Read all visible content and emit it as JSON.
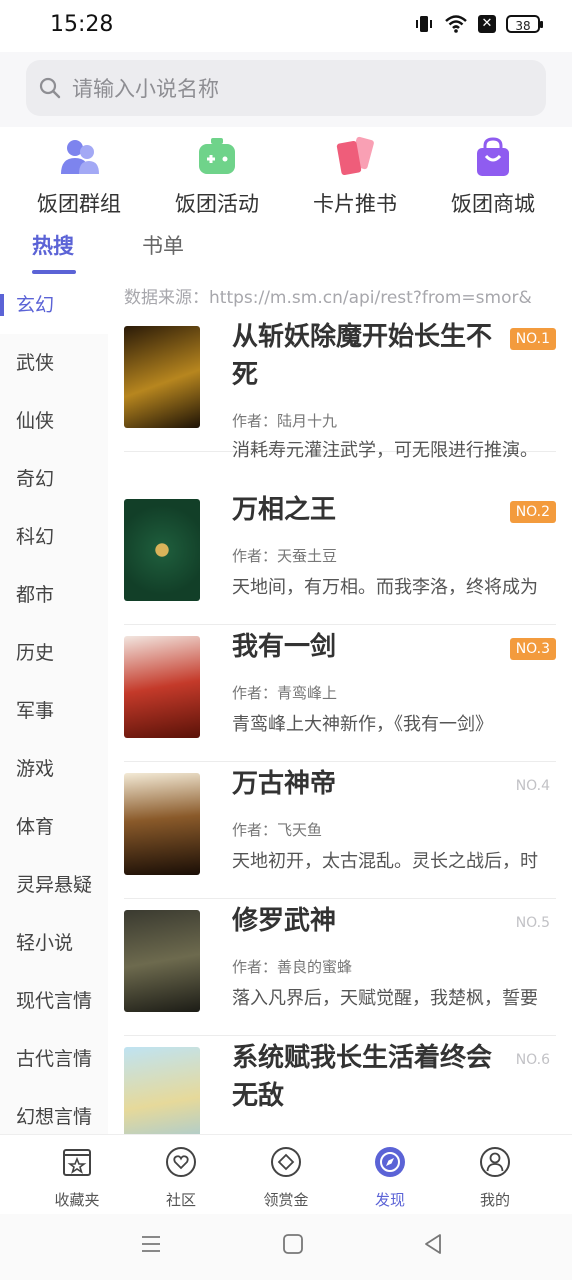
{
  "status": {
    "time": "15:28",
    "battery": "38"
  },
  "search": {
    "placeholder": "请输入小说名称"
  },
  "quick_actions": [
    {
      "label": "饭团群组",
      "icon": "group-users-icon"
    },
    {
      "label": "饭团活动",
      "icon": "game-controller-icon"
    },
    {
      "label": "卡片推书",
      "icon": "cards-icon"
    },
    {
      "label": "饭团商城",
      "icon": "shopping-bag-icon"
    }
  ],
  "tabs": [
    {
      "label": "热搜",
      "active": true
    },
    {
      "label": "书单",
      "active": false
    }
  ],
  "categories": [
    "玄幻",
    "武侠",
    "仙侠",
    "奇幻",
    "科幻",
    "都市",
    "历史",
    "军事",
    "游戏",
    "体育",
    "灵异悬疑",
    "轻小说",
    "现代言情",
    "古代言情",
    "幻想言情"
  ],
  "active_category": "玄幻",
  "source_note": "数据来源：https://m.sm.cn/api/rest?from=smor&",
  "books": [
    {
      "title": "从斩妖除魔开始长生不死",
      "author": "作者：陆月十九",
      "desc": "消耗寿元灌注武学，可无限进行推演。",
      "rank": "NO.1"
    },
    {
      "title": "万相之王",
      "author": "作者：天蚕土豆",
      "desc": "天地间，有万相。而我李洛，终将成为",
      "rank": "NO.2"
    },
    {
      "title": "我有一剑",
      "author": "作者：青鸾峰上",
      "desc": "青鸾峰上大神新作，《我有一剑》",
      "rank": "NO.3"
    },
    {
      "title": "万古神帝",
      "author": "作者：飞天鱼",
      "desc": "天地初开，太古混乱。灵长之战后，时",
      "rank": "NO.4"
    },
    {
      "title": "修罗武神",
      "author": "作者：善良的蜜蜂",
      "desc": "落入凡界后，天赋觉醒，我楚枫，誓要",
      "rank": "NO.5"
    },
    {
      "title": "系统赋我长生活着终会无敌",
      "author": "",
      "desc": "",
      "rank": "NO.6"
    }
  ],
  "bottom_nav": [
    {
      "label": "收藏夹",
      "icon": "bookshelf-star-icon"
    },
    {
      "label": "社区",
      "icon": "heart-chat-icon"
    },
    {
      "label": "领赏金",
      "icon": "diamond-icon"
    },
    {
      "label": "发现",
      "icon": "compass-icon",
      "active": true
    },
    {
      "label": "我的",
      "icon": "user-icon"
    }
  ],
  "colors": {
    "accent": "#5b63d6",
    "rank_hot": "#f39b3d"
  }
}
